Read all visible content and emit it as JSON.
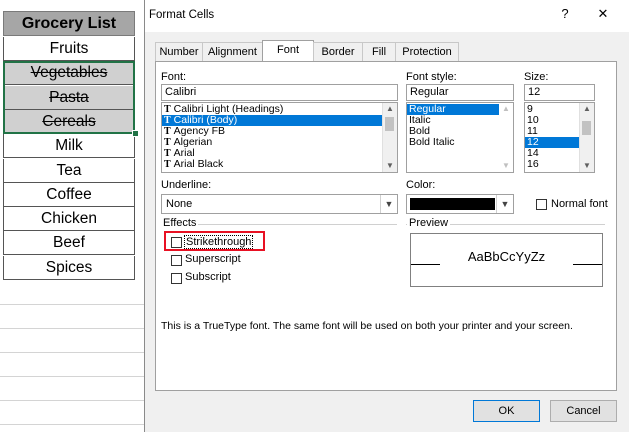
{
  "sheet": {
    "header": "Grocery List",
    "items": [
      {
        "text": "Fruits",
        "strike": false
      },
      {
        "text": "Vegetables",
        "strike": true
      },
      {
        "text": "Pasta",
        "strike": true
      },
      {
        "text": "Cereals",
        "strike": true
      },
      {
        "text": "Milk",
        "strike": false
      },
      {
        "text": "Tea",
        "strike": false
      },
      {
        "text": "Coffee",
        "strike": false
      },
      {
        "text": "Chicken",
        "strike": false
      },
      {
        "text": "Beef",
        "strike": false
      },
      {
        "text": "Spices",
        "strike": false
      }
    ]
  },
  "dialog": {
    "title": "Format Cells",
    "help": "?",
    "close": "✕",
    "tabs": [
      "Number",
      "Alignment",
      "Font",
      "Border",
      "Fill",
      "Protection"
    ],
    "active_tab": "Font",
    "font_label": "Font:",
    "font_value": "Calibri",
    "font_list": [
      "Calibri Light (Headings)",
      "Calibri (Body)",
      "Agency FB",
      "Algerian",
      "Arial",
      "Arial Black"
    ],
    "font_selected": "Calibri (Body)",
    "style_label": "Font style:",
    "style_value": "Regular",
    "style_list": [
      "Regular",
      "Italic",
      "Bold",
      "Bold Italic"
    ],
    "size_label": "Size:",
    "size_value": "12",
    "size_list": [
      "9",
      "10",
      "11",
      "12",
      "14",
      "16"
    ],
    "underline_label": "Underline:",
    "underline_value": "None",
    "color_label": "Color:",
    "color_value": "#000000",
    "normal_font_label": "Normal font",
    "effects_label": "Effects",
    "strikethrough_label": "Strikethrough",
    "superscript_label": "Superscript",
    "subscript_label": "Subscript",
    "preview_label": "Preview",
    "preview_text": "AaBbCcYyZz",
    "info_text": "This is a TrueType font.  The same font will be used on both your printer and your screen.",
    "ok_label": "OK",
    "cancel_label": "Cancel",
    "tt_glyph": "T"
  }
}
